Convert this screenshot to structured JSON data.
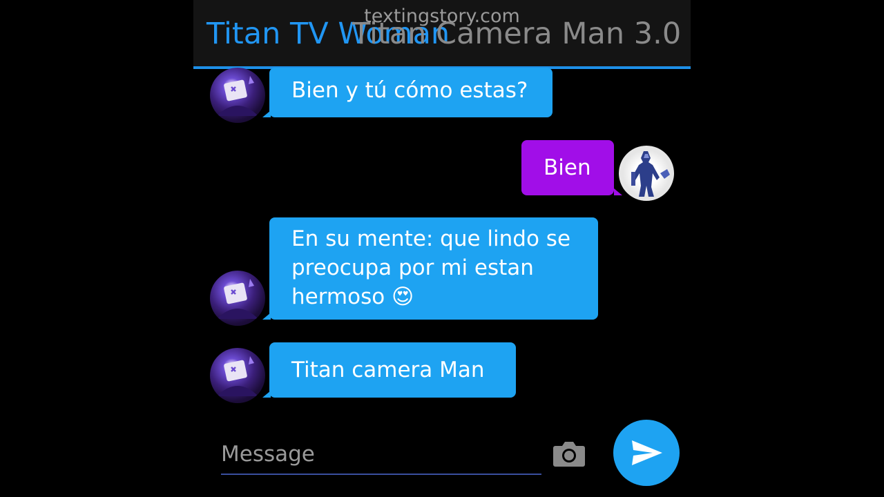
{
  "header": {
    "watermark": "textingstory.com",
    "title_left": "Titan TV Woman",
    "title_right": "Titan Camera Man 3.0",
    "accent_color": "#1e90e8"
  },
  "messages": [
    {
      "side": "incoming",
      "text": "Bien y tú cómo estas?",
      "avatar": "purple-tv-avatar"
    },
    {
      "side": "outgoing",
      "text": "Bien",
      "avatar": "armored-knight-avatar"
    },
    {
      "side": "incoming",
      "lines": [
        "En su mente: que lindo se",
        "preocupa por mi estan",
        "hermoso 😍"
      ],
      "avatar": "purple-tv-avatar"
    },
    {
      "side": "incoming",
      "text": "Titan camera Man",
      "avatar": "purple-tv-avatar"
    }
  ],
  "composer": {
    "placeholder": "Message",
    "camera_icon": "camera-icon",
    "send_icon": "send-icon"
  },
  "colors": {
    "incoming_bubble": "#1ea3f2",
    "outgoing_bubble": "#a10ee8",
    "background": "#000000"
  }
}
